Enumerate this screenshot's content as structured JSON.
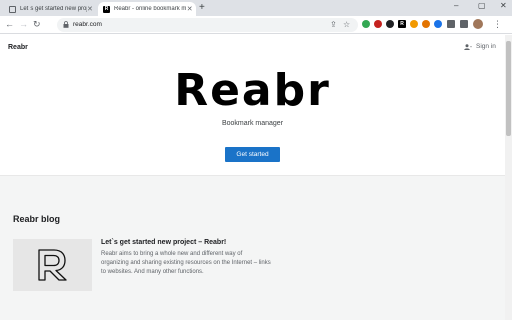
{
  "browser": {
    "tabs": [
      {
        "title": "Let`s get started new project - R",
        "active": false
      },
      {
        "title": "Reabr - online bookmark manag",
        "active": true
      }
    ],
    "new_tab": "+",
    "window_controls": {
      "minimize": "–",
      "maximize": "▢",
      "close": "✕"
    },
    "url": "reabr.com",
    "nav": {
      "back": "←",
      "forward": "→",
      "reload": "↻"
    }
  },
  "header": {
    "brand": "Reabr",
    "signin": "Sign in"
  },
  "hero": {
    "title": "Reabr",
    "subtitle": "Bookmark manager",
    "cta": "Get started"
  },
  "blog": {
    "heading": "Reabr blog",
    "posts": [
      {
        "title": "Let`s get started new project – Reabr!",
        "body": "Reabr aims to bring a whole new and different way of organizing and sharing existing resources on the Internet – links to websites. And many other functions."
      }
    ]
  },
  "colors": {
    "accent": "#1a73c8",
    "blog_bg": "#f4f5f5"
  }
}
